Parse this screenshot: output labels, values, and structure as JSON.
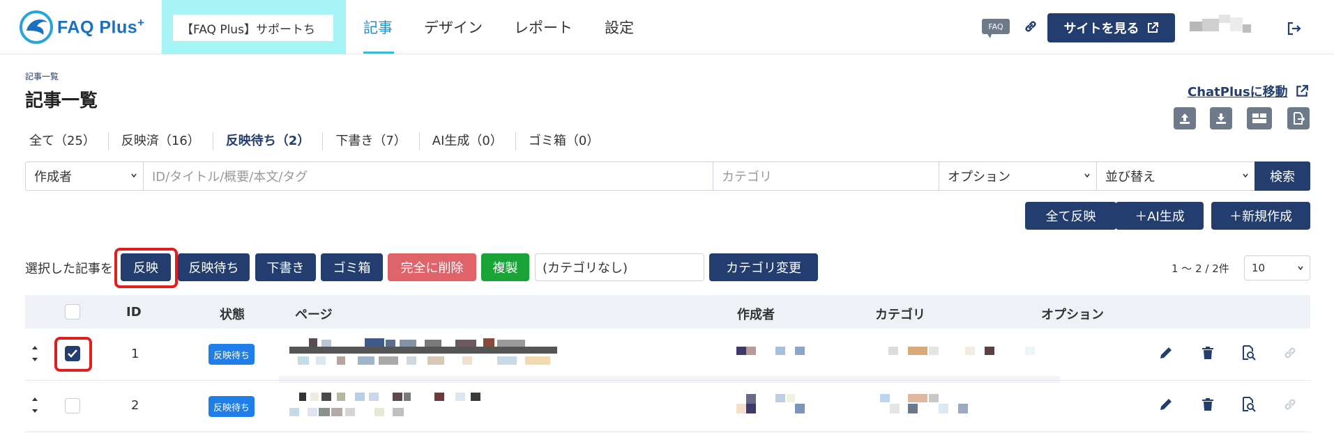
{
  "app": {
    "brand": "FAQ Plus",
    "brand_sup": "+",
    "site_selector": "【FAQ Plus】サポートち"
  },
  "nav": {
    "tabs": [
      {
        "label": "記事",
        "active": true
      },
      {
        "label": "デザイン",
        "active": false
      },
      {
        "label": "レポート",
        "active": false
      },
      {
        "label": "設定",
        "active": false
      }
    ],
    "faq_badge": "FAQ",
    "view_site": "サイトを見る"
  },
  "header": {
    "breadcrumb": "記事一覧",
    "title": "記事一覧",
    "chatplus_link": "ChatPlusに移動"
  },
  "filters": {
    "tabs": [
      {
        "label": "全て（25）",
        "active": false
      },
      {
        "label": "反映済（16）",
        "active": false
      },
      {
        "label": "反映待ち（2）",
        "active": true
      },
      {
        "label": "下書き（7）",
        "active": false
      },
      {
        "label": "AI生成（0）",
        "active": false
      },
      {
        "label": "ゴミ箱（0）",
        "active": false
      }
    ]
  },
  "search": {
    "author": "作成者",
    "keyword_placeholder": "ID/タイトル/概要/本文/タグ",
    "category_placeholder": "カテゴリ",
    "option": "オプション",
    "sort": "並び替え",
    "button": "検索"
  },
  "actions": {
    "reflect_all": "全て反映",
    "ai_generate": "＋AI生成",
    "new": "＋新規作成"
  },
  "bulk": {
    "label": "選択した記事を",
    "reflect": "反映",
    "pending": "反映待ち",
    "draft": "下書き",
    "trash": "ゴミ箱",
    "delete": "完全に削除",
    "duplicate": "複製",
    "category_select": "(カテゴリなし)",
    "change_category": "カテゴリ変更"
  },
  "pagination": {
    "count": "1 〜 2 / 2件",
    "per_page": "10"
  },
  "table": {
    "headers": {
      "id": "ID",
      "status": "状態",
      "page": "ページ",
      "author": "作成者",
      "category": "カテゴリ",
      "option": "オプション"
    },
    "rows": [
      {
        "id": "1",
        "status": "反映待ち",
        "checked": true
      },
      {
        "id": "2",
        "status": "反映待ち",
        "checked": false
      }
    ]
  },
  "colors": {
    "navy": "#233e6e",
    "accent": "#1f8fd0",
    "danger": "#e0636a",
    "success": "#1aa337",
    "badge": "#1f7ee8",
    "highlight": "#e01e1e"
  }
}
